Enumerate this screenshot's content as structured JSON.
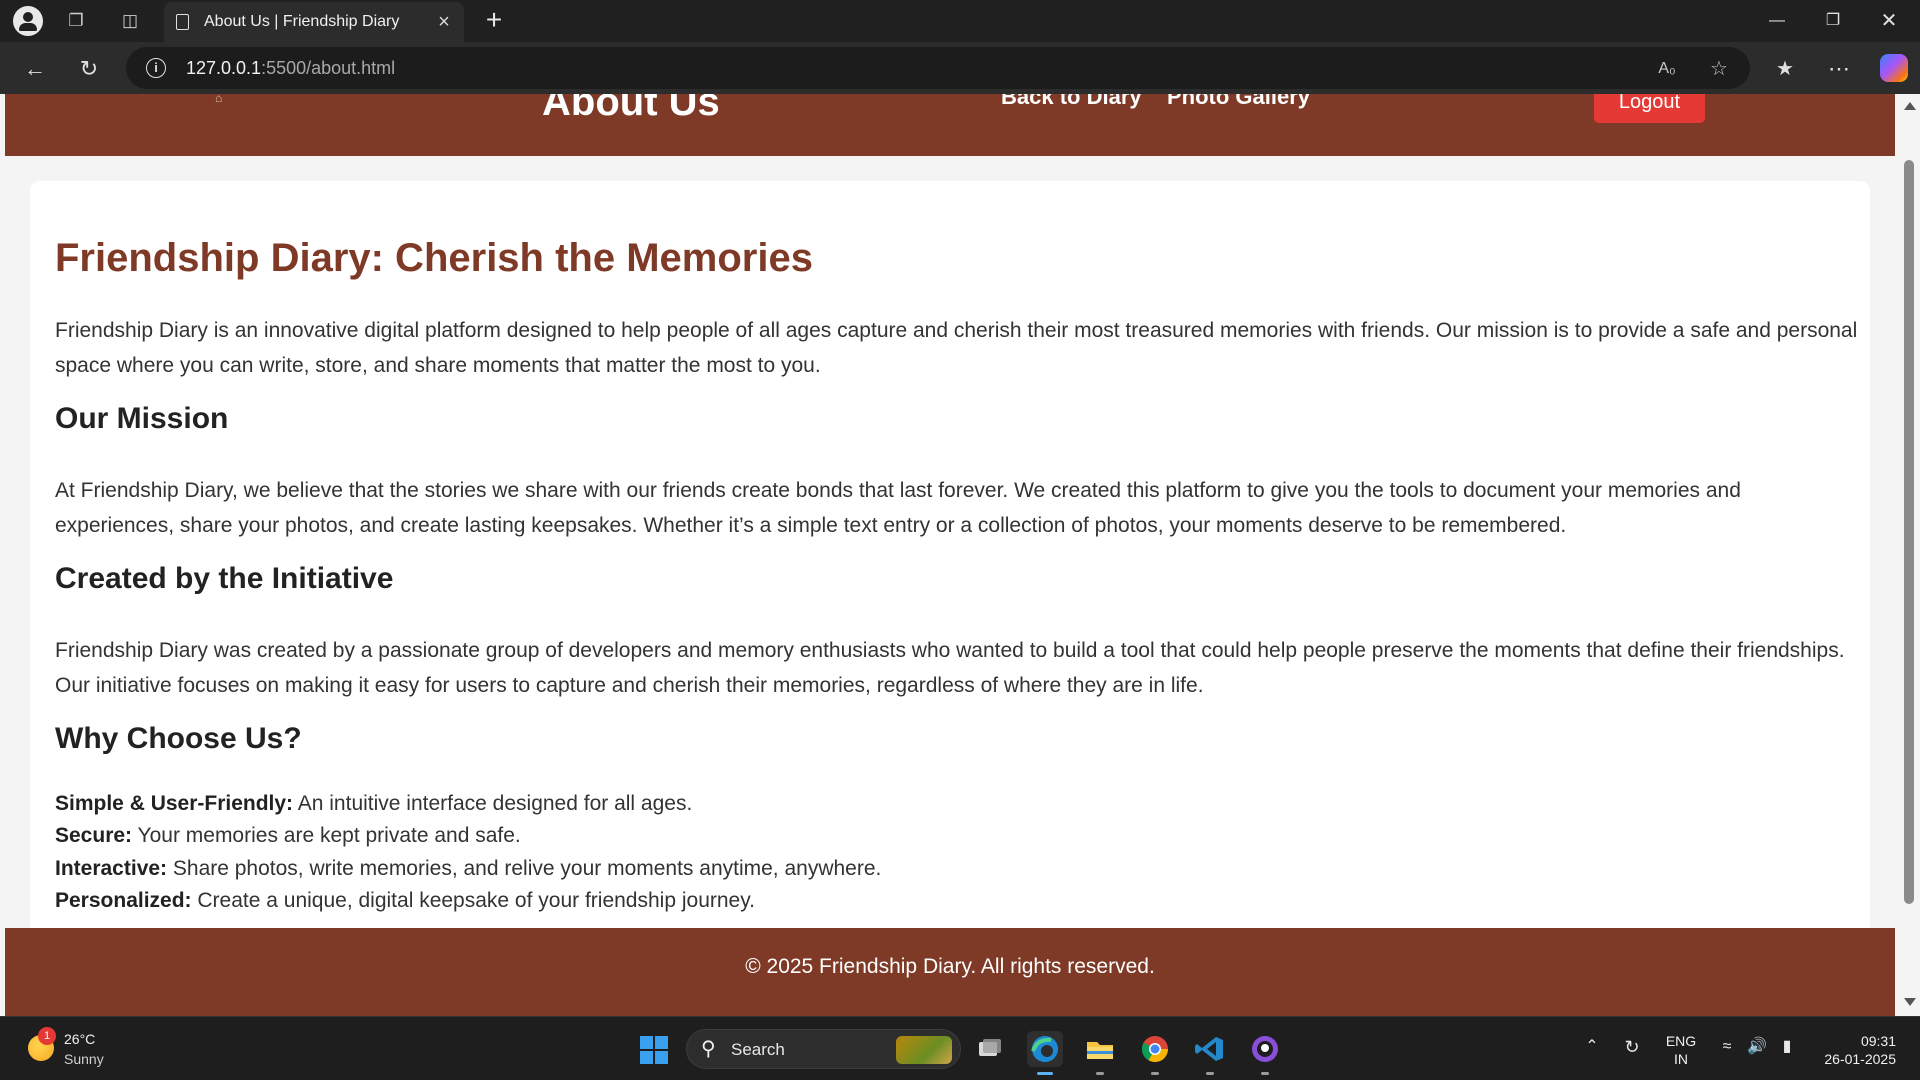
{
  "browser": {
    "tab_title": "About Us | Friendship Diary",
    "url_host": "127.0.0.1",
    "url_path": ":5500/about.html"
  },
  "header": {
    "title": "About Us",
    "nav": [
      "Back to Diary",
      "Photo Gallery"
    ],
    "logout_label": "Logout"
  },
  "main": {
    "title": "Friendship Diary: Cherish the Memories",
    "intro": "Friendship Diary is an innovative digital platform designed to help people of all ages capture and cherish their most treasured memories with friends. Our mission is to provide a safe and personal space where you can write, store, and share moments that matter the most to you.",
    "sections": [
      {
        "heading": "Our Mission",
        "body": "At Friendship Diary, we believe that the stories we share with our friends create bonds that last forever. We created this platform to give you the tools to document your memories and experiences, share your photos, and create lasting keepsakes. Whether it’s a simple text entry or a collection of photos, your moments deserve to be remembered."
      },
      {
        "heading": "Created by the Initiative",
        "body": "Friendship Diary was created by a passionate group of developers and memory enthusiasts who wanted to build a tool that could help people preserve the moments that define their friendships. Our initiative focuses on making it easy for users to capture and cherish their memories, regardless of where they are in life."
      },
      {
        "heading": "Why Choose Us?"
      }
    ],
    "features": [
      {
        "label": "Simple & User-Friendly:",
        "text": " An intuitive interface designed for all ages."
      },
      {
        "label": "Secure:",
        "text": " Your memories are kept private and safe."
      },
      {
        "label": "Interactive:",
        "text": " Share photos, write memories, and relive your moments anytime, anywhere."
      },
      {
        "label": "Personalized:",
        "text": " Create a unique, digital keepsake of your friendship journey."
      }
    ]
  },
  "footer": {
    "text": "© 2025 Friendship Diary. All rights reserved."
  },
  "taskbar": {
    "weather_badge": "1",
    "temperature": "26°C",
    "condition": "Sunny",
    "search_label": "Search",
    "lang_top": "ENG",
    "lang_bottom": "IN",
    "time": "09:31",
    "date": "26-01-2025"
  },
  "colors": {
    "brand_brown": "#7e3a26",
    "logout_red": "#e53935"
  }
}
